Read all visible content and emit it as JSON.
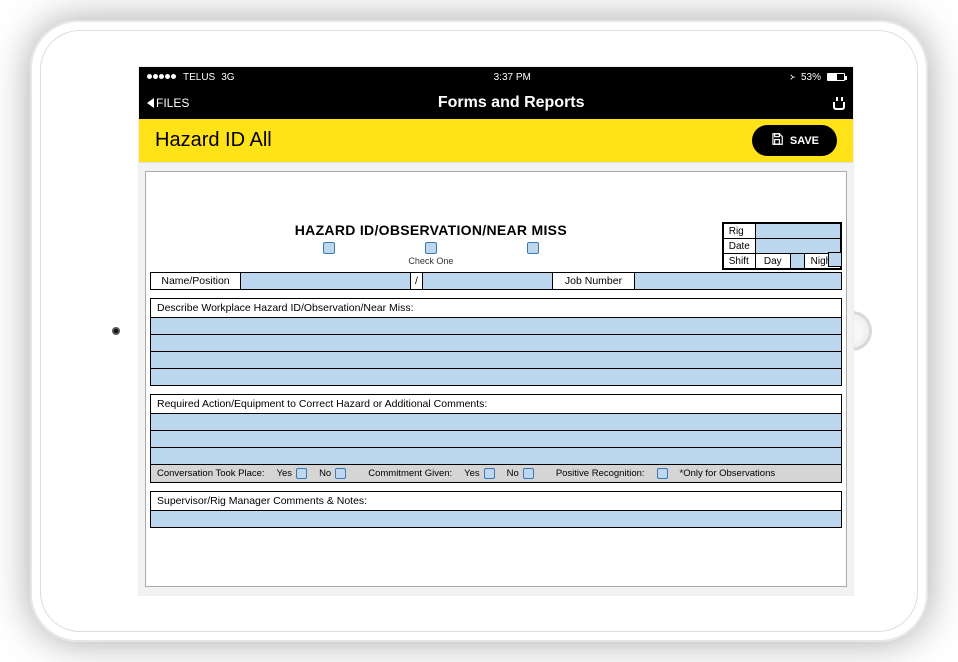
{
  "statusbar": {
    "carrier": "TELUS",
    "network": "3G",
    "time": "3:37 PM",
    "battery": "53%"
  },
  "navbar": {
    "back_label": "FILES",
    "title": "Forms and Reports"
  },
  "pageheader": {
    "title": "Hazard ID All",
    "save_label": "SAVE"
  },
  "form": {
    "title": "HAZARD ID/OBSERVATION/NEAR MISS",
    "check_one": "Check One",
    "rightbox": {
      "rig": "Rig",
      "date": "Date",
      "shift": "Shift",
      "day": "Day",
      "night": "Night"
    },
    "row": {
      "name_position": "Name/Position",
      "slash": "/",
      "job_number": "Job Number"
    },
    "section_describe": "Describe Workplace Hazard ID/Observation/Near Miss:",
    "section_action": "Required Action/Equipment to Correct Hazard or Additional Comments:",
    "footer": {
      "conversation": "Conversation Took Place:",
      "yes": "Yes",
      "no": "No",
      "commitment": "Commitment Given:",
      "positive": "Positive Recognition:",
      "only_obs": "*Only for Observations"
    },
    "section_supervisor": "Supervisor/Rig Manager Comments & Notes:"
  }
}
